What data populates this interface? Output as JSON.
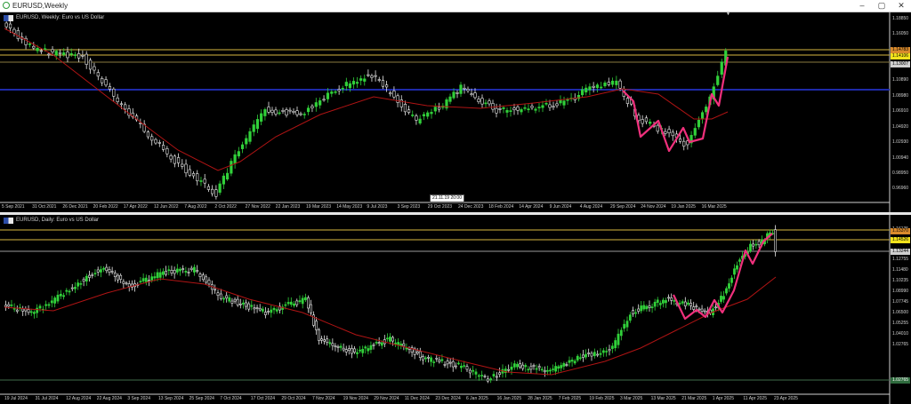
{
  "window": {
    "title": "EURUSD,Weekly",
    "buttons": {
      "minimize": "–",
      "maximize": "▢",
      "close": "✕"
    }
  },
  "weekly": {
    "title": "EURUSD, Weekly:  Euro vs US Dollar",
    "time_labels": [
      "5 Sep 2021",
      "31 Oct 2021",
      "26 Dec 2021",
      "20 Feb 2022",
      "17 Apr 2022",
      "12 Jun 2022",
      "7 Aug 2022",
      "2 Oct 2022",
      "27 Nov 2022",
      "22 Jan 2023",
      "19 Mar 2023",
      "14 May 2023",
      "9 Jul 2023",
      "3 Sep 2023",
      "29 Oct 2023",
      "24 Dec 2023",
      "18 Feb 2024",
      "14 Apr 2024",
      "9 Jun 2024",
      "4 Aug 2024",
      "29 Sep 2024",
      "24 Nov 2024",
      "19 Jan 2025",
      "16 Mar 2025"
    ],
    "price_labels": [
      "1.18850",
      "1.16050",
      "1.10890",
      "1.08980",
      "1.06910",
      "1.04920",
      "1.02930",
      "1.00940",
      "0.98950",
      "0.96960"
    ],
    "price_tags": [
      "1.14783",
      "1.14106",
      "1.13007"
    ],
    "crosshair_time": [
      "21.11.19",
      "20:00"
    ]
  },
  "daily": {
    "title": "EURUSD, Daily:  Euro vs US Dollar",
    "time_labels": [
      "19 Jul 2024",
      "31 Jul 2024",
      "12 Aug 2024",
      "22 Aug 2024",
      "3 Sep 2024",
      "13 Sep 2024",
      "25 Sep 2024",
      "7 Oct 2024",
      "17 Oct 2024",
      "29 Oct 2024",
      "7 Nov 2024",
      "19 Nov 2024",
      "29 Nov 2024",
      "11 Dec 2024",
      "23 Dec 2024",
      "6 Jan 2025",
      "16 Jan 2025",
      "28 Jan 2025",
      "7 Feb 2025",
      "19 Feb 2025",
      "3 Mar 2025",
      "13 Mar 2025",
      "21 Mar 2025",
      "1 Apr 2025",
      "11 Apr 2025",
      "23 Apr 2025"
    ],
    "price_labels": [
      "1.16135",
      "1.14526",
      "1.13244",
      "1.12755",
      "1.11480",
      "1.10235",
      "1.08990",
      "1.07745",
      "1.06500",
      "1.05255",
      "1.04010",
      "1.02765"
    ],
    "price_tags": [
      "1.15370",
      "1.14526",
      "1.13244",
      "1.02765"
    ]
  },
  "colors": {
    "bull": "#31d13a",
    "bear": "#e8e8e8",
    "ma": "#b01414",
    "zigzag": "#f0307c",
    "level": "#d9b840",
    "blue_level": "#1e2aa8"
  }
}
